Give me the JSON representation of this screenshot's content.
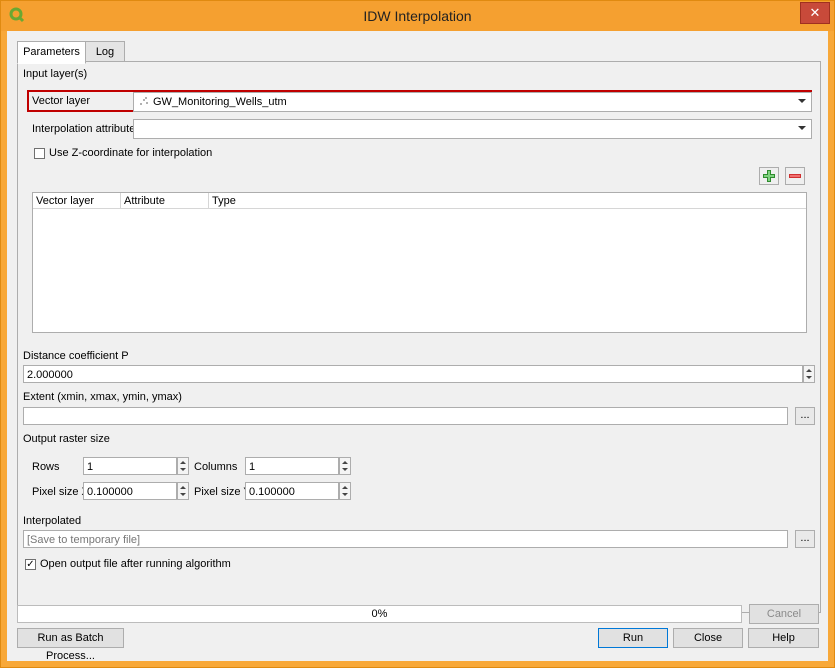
{
  "window": {
    "title": "IDW Interpolation",
    "close_glyph": "✕"
  },
  "tabs": [
    {
      "label": "Parameters"
    },
    {
      "label": "Log"
    }
  ],
  "input": {
    "section_label": "Input layer(s)",
    "vector_layer_label": "Vector layer",
    "vector_layer_value": "GW_Monitoring_Wells_utm",
    "interp_attr_label": "Interpolation attribute",
    "interp_attr_value": "",
    "use_z_label": "Use Z-coordinate for interpolation",
    "use_z_checked": false
  },
  "table": {
    "headers": [
      "Vector layer",
      "Attribute",
      "Type"
    ],
    "rows": []
  },
  "distance": {
    "label": "Distance coefficient P",
    "value": "2.000000"
  },
  "extent": {
    "label": "Extent (xmin, xmax, ymin, ymax)",
    "value": "",
    "button": "..."
  },
  "raster": {
    "label": "Output raster size",
    "rows_label": "Rows",
    "rows_value": "1",
    "columns_label": "Columns",
    "columns_value": "1",
    "pixel_x_label": "Pixel size X",
    "pixel_x_value": "0.100000",
    "pixel_y_label": "Pixel size Y",
    "pixel_y_value": "0.100000"
  },
  "output": {
    "label": "Interpolated",
    "placeholder": "[Save to temporary file]",
    "button": "...",
    "open_after_label": "Open output file after running algorithm",
    "open_after_checked": true,
    "checkmark": "✓"
  },
  "progress": {
    "text": "0%",
    "value": 0
  },
  "buttons": {
    "cancel": "Cancel",
    "batch": "Run as Batch Process...",
    "run": "Run",
    "close": "Close",
    "help": "Help"
  },
  "colors": {
    "title_bar": "#f5a030",
    "highlight_border": "#c00000",
    "add_icon": "#2e8b2e",
    "remove_icon": "#d03030"
  }
}
